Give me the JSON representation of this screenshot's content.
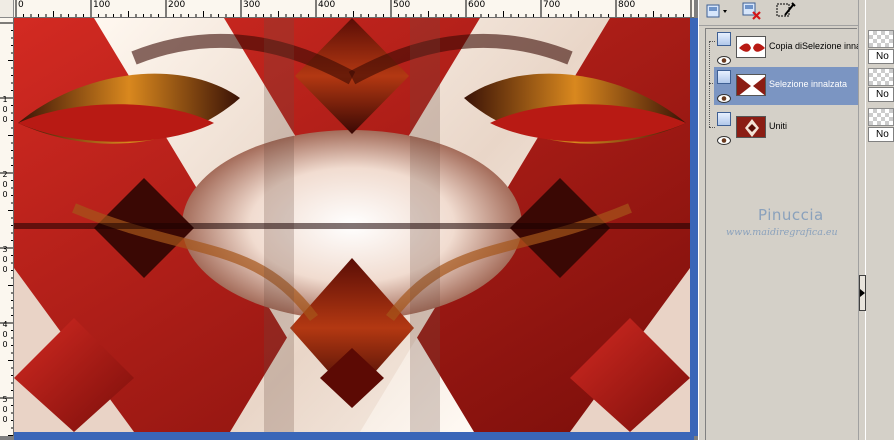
{
  "canvas": {
    "ruler_top_labels": [
      "0",
      "100",
      "200",
      "300",
      "400",
      "500",
      "600",
      "700",
      "800"
    ],
    "ruler_left_labels": [
      "1",
      "0",
      "0",
      "2",
      "0",
      "0",
      "3",
      "0",
      "0",
      "4",
      "0",
      "0",
      "5",
      "0",
      "0"
    ]
  },
  "layers_panel": {
    "toolbar": {
      "new_layer_icon": "layer-stack-icon",
      "delete_layer_icon": "delete-layer-icon",
      "edit_icon": "brush-edit-icon"
    },
    "layers": [
      {
        "name": "Copia diSelezione innalzata",
        "selected": false,
        "visible": true
      },
      {
        "name": "Selezione innalzata",
        "selected": true,
        "visible": true
      },
      {
        "name": "Uniti",
        "selected": false,
        "visible": true
      }
    ]
  },
  "watermark": {
    "name": "Pinuccia",
    "url": "www.maidiregrafica.eu"
  },
  "opacity_column": {
    "blend_modes": [
      "No",
      "No",
      "No"
    ]
  },
  "colors": {
    "selection": "#7b95c2",
    "scroll_accent": "#3a66b8",
    "watermark": "#8aa1bc"
  }
}
